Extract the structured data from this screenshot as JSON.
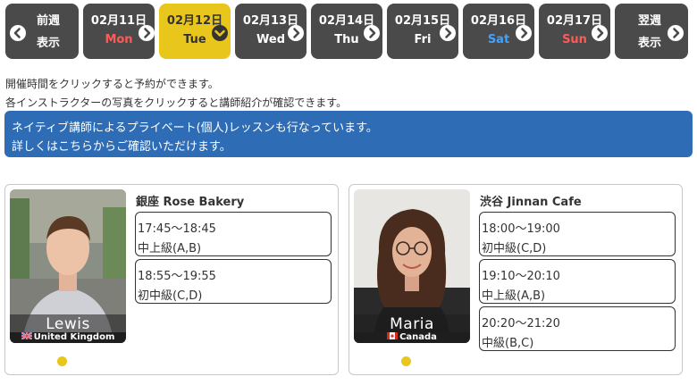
{
  "date_nav": {
    "prev": {
      "line1": "前週",
      "line2": "表示"
    },
    "days": [
      {
        "date": "02月11日",
        "dow": "Mon",
        "dow_class": "dow-mon",
        "active": false
      },
      {
        "date": "02月12日",
        "dow": "Tue",
        "dow_class": "",
        "active": true
      },
      {
        "date": "02月13日",
        "dow": "Wed",
        "dow_class": "",
        "active": false
      },
      {
        "date": "02月14日",
        "dow": "Thu",
        "dow_class": "",
        "active": false
      },
      {
        "date": "02月15日",
        "dow": "Fri",
        "dow_class": "",
        "active": false
      },
      {
        "date": "02月16日",
        "dow": "Sat",
        "dow_class": "dow-sat",
        "active": false
      },
      {
        "date": "02月17日",
        "dow": "Sun",
        "dow_class": "dow-sun",
        "active": false
      }
    ],
    "next": {
      "line1": "翌週",
      "line2": "表示"
    },
    "icons": {
      "left": "chevron-left-icon",
      "right": "chevron-right-icon",
      "down": "chevron-down-icon"
    }
  },
  "info": {
    "line1": "開催時間をクリックすると予約ができます。",
    "line2": "各インストラクターの写真をクリックすると講師紹介が確認できます。"
  },
  "banner": {
    "line1": "ネイティブ講師によるプライベート(個人)レッスンも行なっています。",
    "line2": "詳しくはこちらからご確認いただけます。"
  },
  "colors": {
    "nav_bg": "#4a4a4a",
    "active": "#e9c61c",
    "banner": "#2e6db5",
    "saturday": "#3fa3ff",
    "sunday": "#ff5a5a"
  },
  "instructors": [
    {
      "name": "Lewis",
      "country": "United Kingdom",
      "flag": "uk-flag-icon",
      "venue": "銀座 Rose Bakery",
      "slots": [
        {
          "time": "17:45～18:45",
          "level": "中上級(A,B)"
        },
        {
          "time": "18:55～19:55",
          "level": "初中級(C,D)"
        }
      ]
    },
    {
      "name": "Maria",
      "country": "Canada",
      "flag": "canada-flag-icon",
      "venue": "渋谷 Jinnan Cafe",
      "slots": [
        {
          "time": "18:00～19:00",
          "level": "初中級(C,D)"
        },
        {
          "time": "19:10～20:10",
          "level": "中上級(A,B)"
        },
        {
          "time": "20:20～21:20",
          "level": "中級(B,C)"
        }
      ]
    }
  ]
}
